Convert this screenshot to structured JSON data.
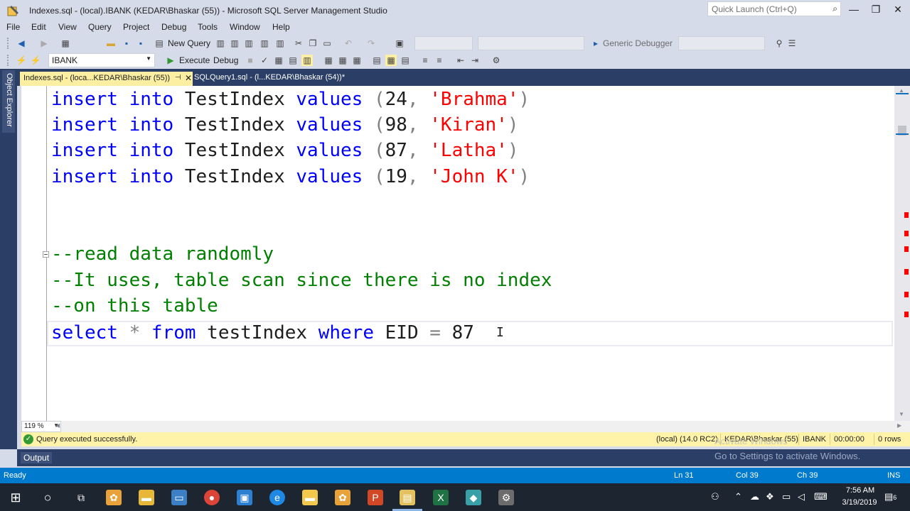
{
  "window": {
    "title": "Indexes.sql - (local).IBANK (KEDAR\\Bhaskar (55)) - Microsoft SQL Server Management Studio",
    "quick_launch_placeholder": "Quick Launch (Ctrl+Q)",
    "minimize": "—",
    "maximize": "❐",
    "close": "✕"
  },
  "menu": [
    "File",
    "Edit",
    "View",
    "Query",
    "Project",
    "Debug",
    "Tools",
    "Window",
    "Help"
  ],
  "toolbar1": {
    "new_query": "New Query",
    "generic_debugger": "Generic Debugger"
  },
  "toolbar2": {
    "database": "IBANK",
    "execute": "Execute",
    "debug": "Debug"
  },
  "object_explorer_label": "Object Explorer",
  "tabs": {
    "active": "Indexes.sql - (loca...KEDAR\\Bhaskar (55))",
    "active_pin": "⊣",
    "active_close": "✕",
    "inactive": "SQLQuery1.sql - (l...KEDAR\\Bhaskar (54))*"
  },
  "code": {
    "insert_rows": [
      {
        "id": "24",
        "name": "'Brahma'"
      },
      {
        "id": "98",
        "name": "'Kiran'"
      },
      {
        "id": "87",
        "name": "'Latha'"
      },
      {
        "id": "19",
        "name": "'John K'"
      }
    ],
    "insert_kw": "insert",
    "into_kw": "into",
    "table": "TestIndex",
    "values_kw": "values",
    "comment1": "--read data randomly",
    "comment2": "--It uses, table scan since there is no index",
    "comment3": "--on this table",
    "select_kw": "select",
    "star": "*",
    "from_kw": "from",
    "select_table": "testIndex",
    "where_kw": "where",
    "column": "EID",
    "equals": "=",
    "value": "87"
  },
  "zoom": "119 %",
  "query_status": {
    "message": "Query executed successfully.",
    "server": "(local) (14.0 RC2)",
    "user": "KEDAR\\Bhaskar (55)",
    "database": "IBANK",
    "elapsed": "00:00:00",
    "rows": "0 rows"
  },
  "output_label": "Output",
  "activate_text": "Go to Settings to activate Windows.",
  "activate_text_top": "Activate Windows",
  "statusbar": {
    "state": "Ready",
    "line": "Ln 31",
    "col": "Col 39",
    "ch": "Ch 39",
    "mode": "INS"
  },
  "taskbar": {
    "time": "7:56 AM",
    "date": "3/19/2019",
    "notification_count": "6"
  }
}
